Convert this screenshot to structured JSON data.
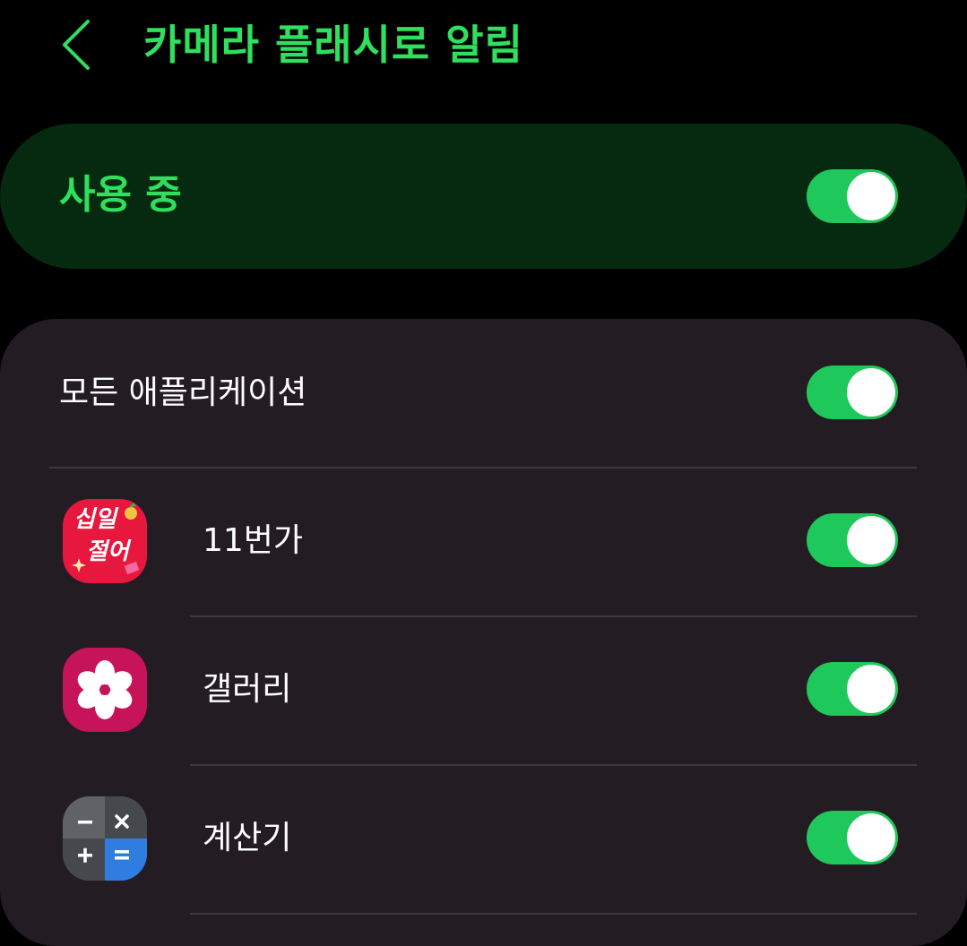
{
  "header": {
    "back_icon": "chevron-left-icon",
    "title": "카메라 플래시로 알림"
  },
  "master": {
    "label": "사용 중",
    "on": true
  },
  "list": {
    "all_apps": {
      "label": "모든 애플리케이션",
      "on": true
    },
    "apps": [
      {
        "label": "11번가",
        "icon": "11st-app-icon",
        "icon_text_top": "십일",
        "icon_text_bottom": "절어",
        "on": true
      },
      {
        "label": "갤러리",
        "icon": "gallery-flower-icon",
        "on": true
      },
      {
        "label": "계산기",
        "icon": "calculator-icon",
        "on": true
      }
    ]
  },
  "colors": {
    "background": "#000000",
    "accent_green": "#2fdf5e",
    "master_card_bg": "#062a0f",
    "list_card_bg": "#231c22",
    "switch_on": "#1fc85a",
    "divider": "#3e373d",
    "text_white": "#ffffff"
  }
}
